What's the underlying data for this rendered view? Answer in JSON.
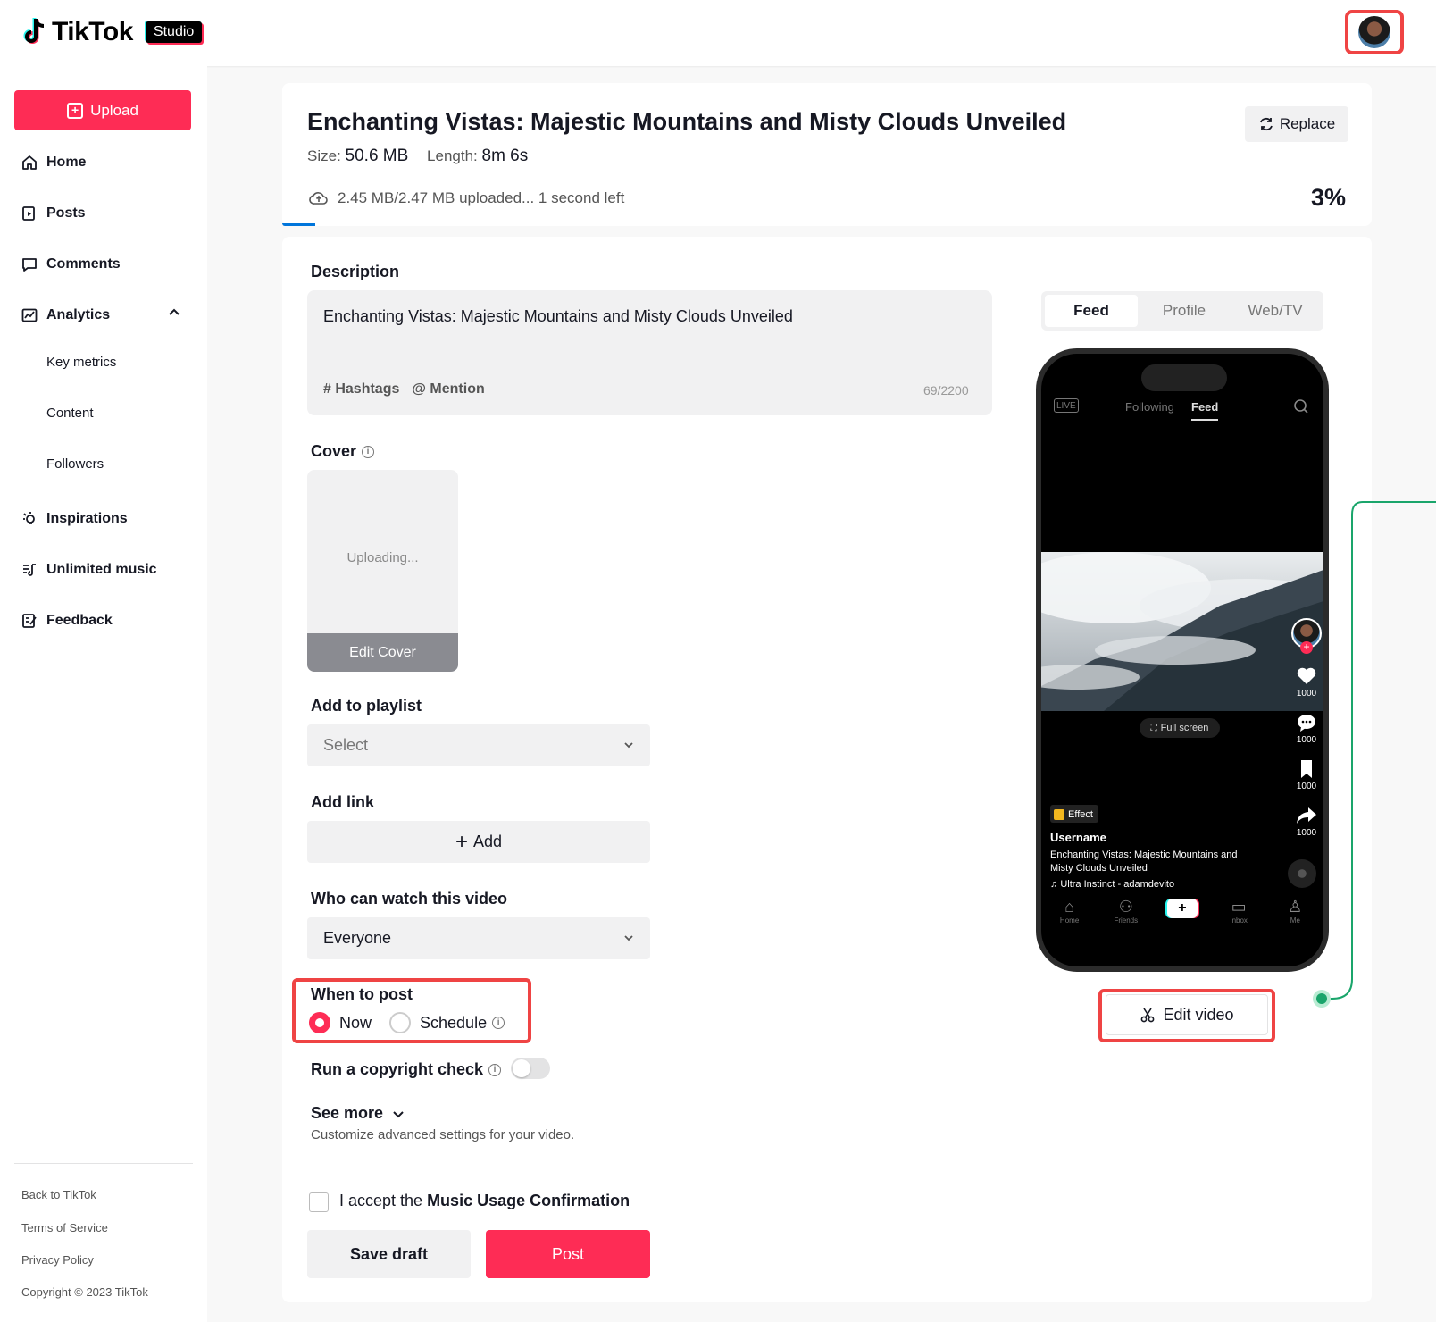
{
  "header": {
    "logo_text": "TikTok",
    "studio_label": "Studio",
    "avatar_icon": "user-avatar"
  },
  "sidebar": {
    "upload_label": "Upload",
    "items": [
      {
        "label": "Home",
        "icon": "home-icon"
      },
      {
        "label": "Posts",
        "icon": "posts-icon"
      },
      {
        "label": "Comments",
        "icon": "comment-icon"
      },
      {
        "label": "Analytics",
        "icon": "analytics-icon"
      },
      {
        "label": "Inspirations",
        "icon": "lightbulb-icon"
      },
      {
        "label": "Unlimited music",
        "icon": "music-list-icon"
      },
      {
        "label": "Feedback",
        "icon": "feedback-icon"
      }
    ],
    "analytics_sub": [
      "Key metrics",
      "Content",
      "Followers"
    ],
    "footer": [
      "Back to TikTok",
      "Terms of Service",
      "Privacy Policy",
      "Copyright © 2023 TikTok"
    ]
  },
  "upload": {
    "title": "Enchanting Vistas: Majestic Mountains and Misty Clouds Unveiled",
    "size_label": "Size:",
    "size_value": "50.6 MB",
    "length_label": "Length:",
    "length_value": "8m 6s",
    "replace_label": "Replace",
    "progress_text": "2.45 MB/2.47 MB uploaded... 1 second left",
    "progress_percent": "3%",
    "progress_fraction": 0.03
  },
  "form": {
    "description_label": "Description",
    "description_value": "Enchanting Vistas: Majestic Mountains and Misty Clouds Unveiled",
    "hashtags_label": "Hashtags",
    "mention_label": "Mention",
    "char_count": "69/2200",
    "cover_label": "Cover",
    "cover_status": "Uploading...",
    "edit_cover_label": "Edit Cover",
    "playlist_label": "Add to playlist",
    "playlist_placeholder": "Select",
    "link_label": "Add link",
    "link_add_label": "Add",
    "privacy_label": "Who can watch this video",
    "privacy_value": "Everyone",
    "when_label": "When to post",
    "when_now": "Now",
    "when_schedule": "Schedule",
    "copyright_label": "Run a copyright check",
    "see_more_label": "See more",
    "see_more_sub": "Customize advanced settings for your video.",
    "accept_prefix": "I accept the ",
    "accept_bold": "Music Usage Confirmation",
    "save_draft_label": "Save draft",
    "post_label": "Post"
  },
  "preview": {
    "tabs": [
      "Feed",
      "Profile",
      "Web/TV"
    ],
    "phone_following": "Following",
    "phone_feed": "Feed",
    "phone_live": "LIVE",
    "fullscreen_label": "Full screen",
    "stat_likes": "1000",
    "stat_comments": "1000",
    "stat_saves": "1000",
    "stat_shares": "1000",
    "effect_label": "Effect",
    "username": "Username",
    "caption": "Enchanting Vistas: Majestic Mountains and Misty Clouds Unveiled",
    "music": "Ultra Instinct - adamdevito",
    "nav": [
      "Home",
      "Friends",
      "Inbox",
      "Me"
    ],
    "edit_video_label": "Edit video"
  },
  "colors": {
    "brand": "#fe2c55",
    "highlight": "#ef4444",
    "connector": "#1aa56b"
  }
}
